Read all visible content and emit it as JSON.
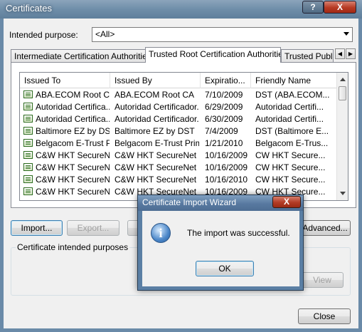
{
  "window": {
    "title": "Certificates",
    "help_button": "?",
    "close_button": "X"
  },
  "purpose": {
    "label": "Intended purpose:",
    "value": "<All>"
  },
  "tabs": [
    {
      "label": "Intermediate Certification Authorities"
    },
    {
      "label": "Trusted Root Certification Authorities"
    },
    {
      "label": "Trusted Publi"
    }
  ],
  "tab_scroll": {
    "left": "◀",
    "right": "▶"
  },
  "columns": [
    "Issued To",
    "Issued By",
    "Expiratio...",
    "Friendly Name"
  ],
  "rows": [
    {
      "issued_to": "ABA.ECOM Root CA",
      "issued_by": "ABA.ECOM Root CA",
      "expiration": "7/10/2009",
      "friendly": "DST (ABA.ECOM..."
    },
    {
      "issued_to": "Autoridad Certifica...",
      "issued_by": "Autoridad Certificador...",
      "expiration": "6/29/2009",
      "friendly": "Autoridad Certifi..."
    },
    {
      "issued_to": "Autoridad Certifica...",
      "issued_by": "Autoridad Certificador...",
      "expiration": "6/30/2009",
      "friendly": "Autoridad Certifi..."
    },
    {
      "issued_to": "Baltimore EZ by DST",
      "issued_by": "Baltimore EZ by DST",
      "expiration": "7/4/2009",
      "friendly": "DST (Baltimore E..."
    },
    {
      "issued_to": "Belgacom E-Trust P...",
      "issued_by": "Belgacom E-Trust Prim...",
      "expiration": "1/21/2010",
      "friendly": "Belgacom E-Trus..."
    },
    {
      "issued_to": "C&W HKT SecureN...",
      "issued_by": "C&W HKT SecureNet ...",
      "expiration": "10/16/2009",
      "friendly": "CW HKT Secure..."
    },
    {
      "issued_to": "C&W HKT SecureN...",
      "issued_by": "C&W HKT SecureNet ...",
      "expiration": "10/16/2009",
      "friendly": "CW HKT Secure..."
    },
    {
      "issued_to": "C&W HKT SecureN...",
      "issued_by": "C&W HKT SecureNet ...",
      "expiration": "10/16/2010",
      "friendly": "CW HKT Secure..."
    },
    {
      "issued_to": "C&W HKT SecureN...",
      "issued_by": "C&W HKT SecureNet ...",
      "expiration": "10/16/2009",
      "friendly": "CW HKT Secure..."
    }
  ],
  "buttons": {
    "import": "Import...",
    "export": "Export...",
    "advanced": "Advanced...",
    "view": "View",
    "close": "Close"
  },
  "purposes_group": {
    "label": "Certificate intended purposes"
  },
  "dialog": {
    "title": "Certificate Import Wizard",
    "close": "X",
    "message": "The import was successful.",
    "ok": "OK",
    "icon": "info-icon"
  }
}
